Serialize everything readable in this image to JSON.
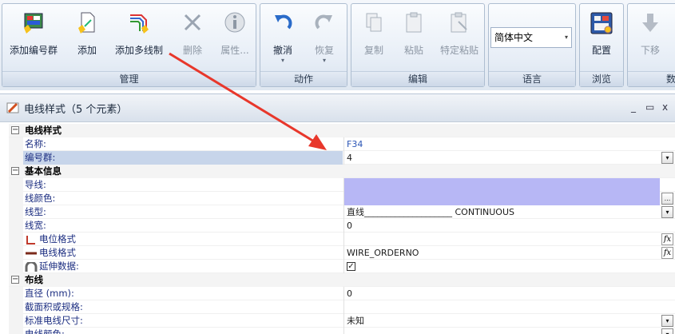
{
  "ribbon": {
    "groups": [
      {
        "id": "manage",
        "label": "管理"
      },
      {
        "id": "action",
        "label": "动作"
      },
      {
        "id": "edit",
        "label": "编辑"
      },
      {
        "id": "language",
        "label": "语言"
      },
      {
        "id": "browse",
        "label": "浏览"
      },
      {
        "id": "data",
        "label": "数"
      }
    ],
    "buttons": {
      "add_number_group": "添加编号群",
      "add": "添加",
      "add_multi_wire": "添加多线制",
      "delete": "删除",
      "properties": "属性...",
      "undo": "撤消",
      "redo": "恢复",
      "copy": "复制",
      "paste": "粘贴",
      "paste_special": "特定粘贴",
      "config": "配置",
      "move_down": "下移"
    },
    "language_select": "简体中文"
  },
  "panel": {
    "title": "电线样式（5 个元素）",
    "controls": {
      "min": "_",
      "restore": "▭",
      "close": "x"
    }
  },
  "grid": {
    "cat1": {
      "label": "电线样式",
      "toggle": "−"
    },
    "r_name": {
      "label": "名称:",
      "value": "F34"
    },
    "r_numgroup": {
      "label": "编号群:",
      "value": "4"
    },
    "cat2": {
      "label": "基本信息",
      "toggle": "−"
    },
    "r_conductor": {
      "label": "导线:",
      "value": ""
    },
    "r_wirecolor": {
      "label": "线颜色:",
      "value": ""
    },
    "r_linetype": {
      "label": "线型:",
      "value": "直线____________________ CONTINUOUS"
    },
    "r_linewidth": {
      "label": "线宽:",
      "value": "0"
    },
    "r_potential": {
      "label": "电位格式",
      "value": ""
    },
    "r_wireformat": {
      "label": "电线格式",
      "value": "WIRE_ORDERNO"
    },
    "r_extdata": {
      "label": "延伸数据:",
      "value": "✓"
    },
    "cat3": {
      "label": "布线",
      "toggle": "−"
    },
    "r_diameter": {
      "label": "直径 (mm):",
      "value": "0"
    },
    "r_section": {
      "label": "截面积或规格:",
      "value": ""
    },
    "r_stdsize": {
      "label": "标准电线尺寸:",
      "value": "未知"
    },
    "r_wirecolor2": {
      "label": "电线颜色:",
      "value": ""
    }
  },
  "icons": {
    "dropdown": "▾",
    "ellipsis": "...",
    "fx": "fx"
  },
  "colors": {
    "selection": "#c7d5ea",
    "highlight_value": "#b7b7f5",
    "arrow": "#e8372b",
    "label_text": "#1b2d80"
  }
}
